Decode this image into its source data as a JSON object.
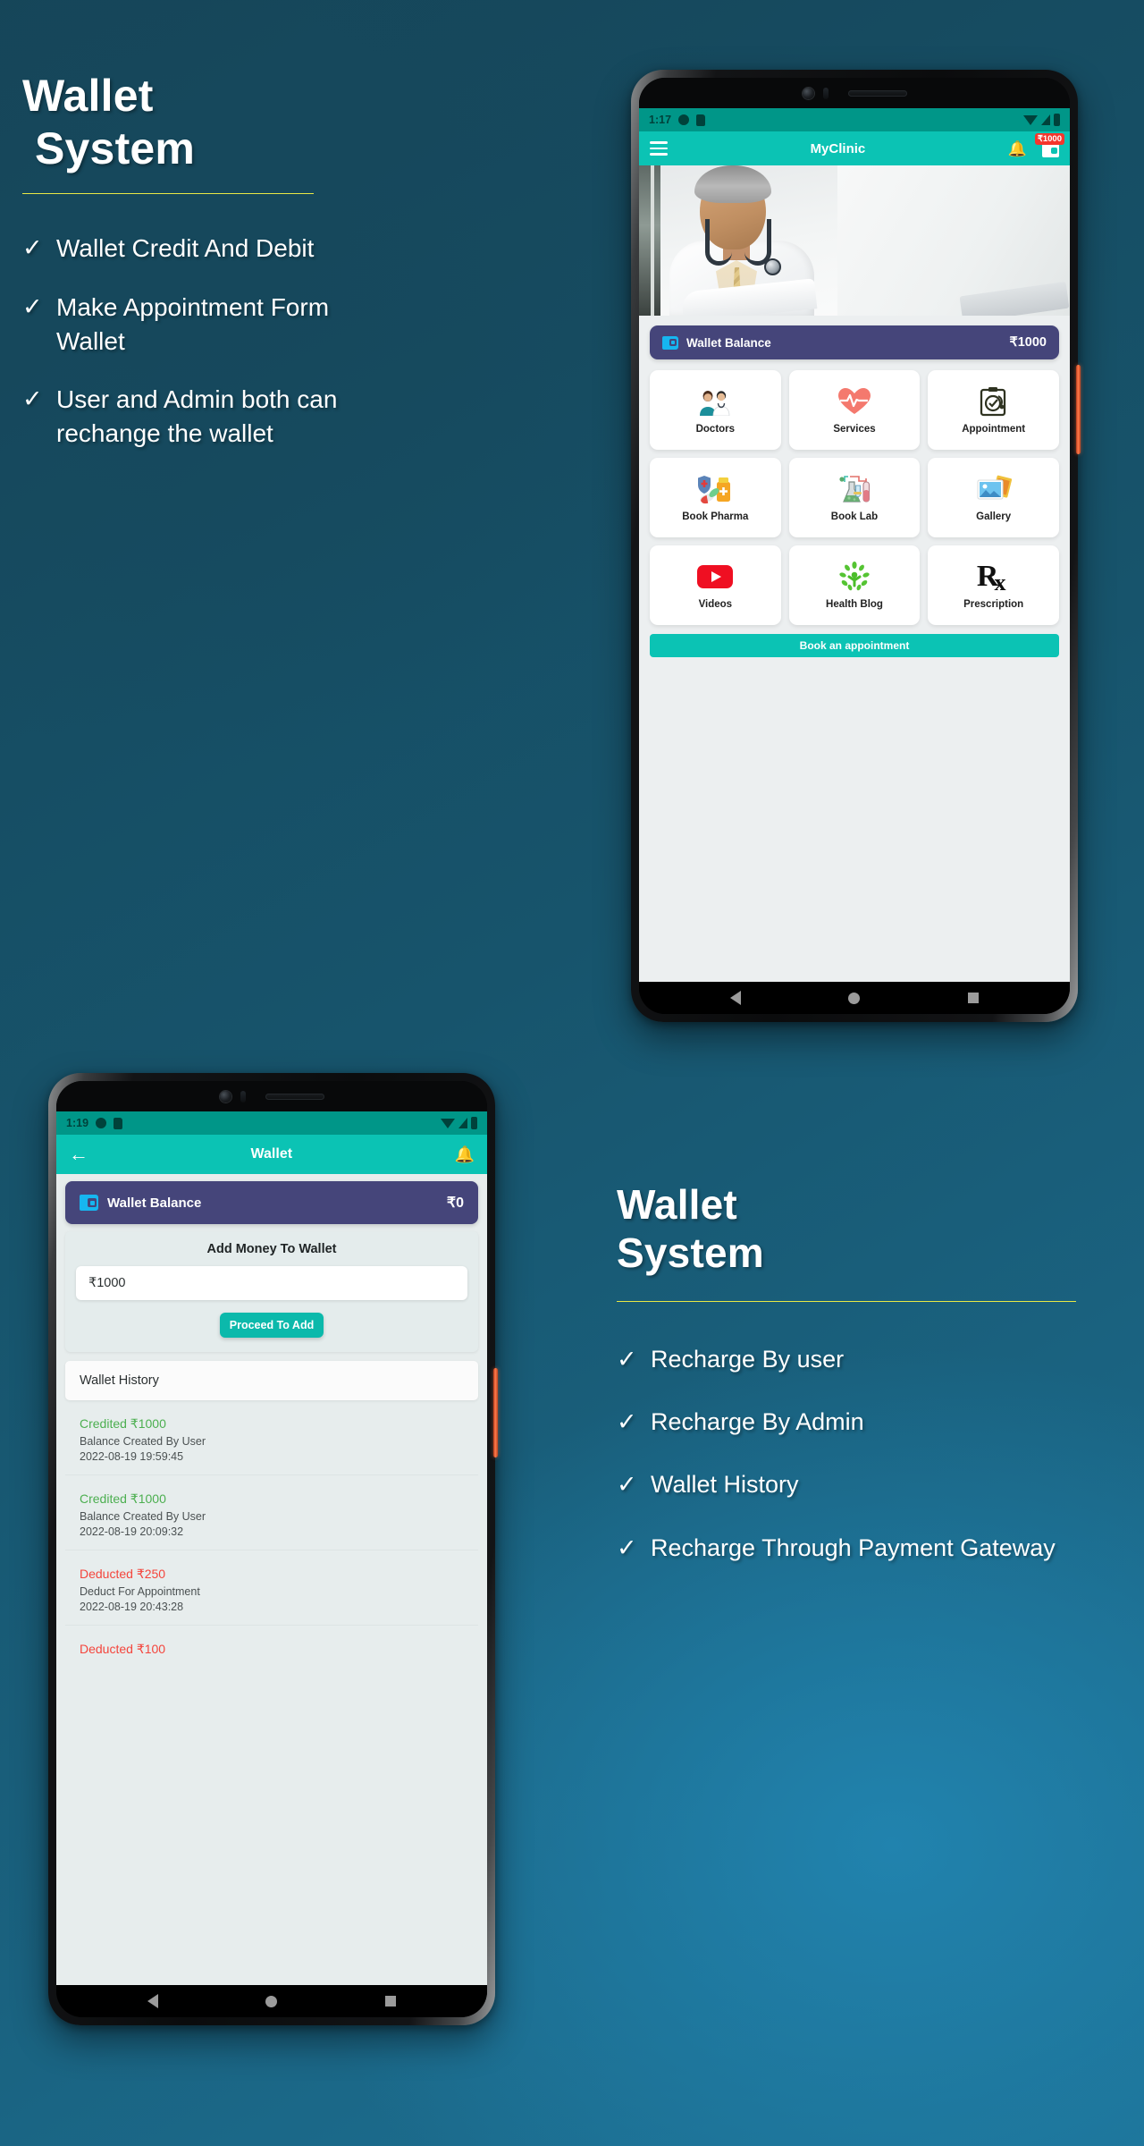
{
  "theme": {
    "bg_dark": "#154457",
    "bg_light": "#1d7296",
    "accent_teal": "#0bc3b4",
    "status_teal": "#009688",
    "wallet_purple": "#45457a",
    "wallet_icon_blue": "#16b6f0",
    "rule_yellow": "#e8e845",
    "credit_green": "#4caf50",
    "debit_red": "#f4453c",
    "badge_red": "#f5352c"
  },
  "promo_top": {
    "title_line1": "Wallet",
    "title_line2": "System",
    "bullets": [
      {
        "tick": "✓",
        "text": "Wallet Credit And Debit"
      },
      {
        "tick": "✓",
        "text": "Make Appointment Form Wallet"
      },
      {
        "tick": "✓",
        "text": "User and Admin both can rechange the wallet"
      }
    ]
  },
  "promo_bottom": {
    "title_line1": "Wallet",
    "title_line2": "System",
    "bullets": [
      {
        "tick": "✓",
        "text": "Recharge By user"
      },
      {
        "tick": "✓",
        "text": "Recharge By Admin"
      },
      {
        "tick": "✓",
        "text": "Wallet History"
      },
      {
        "tick": "✓",
        "text": "Recharge Through Payment Gateway"
      }
    ]
  },
  "phone_home": {
    "statusbar": {
      "time": "1:17",
      "icons": [
        "clock-dot-icon",
        "sd-card-icon",
        "wifi-icon",
        "signal-icon",
        "battery-icon"
      ]
    },
    "appbar": {
      "menu_icon": "hamburger-menu-icon",
      "title": "MyClinic",
      "notification_icon": "bell-icon",
      "wallet_icon": "wallet-icon",
      "wallet_badge": "₹1000"
    },
    "hero_image_alt": "doctor-with-stethoscope-photo",
    "wallet_bar": {
      "icon": "wallet-icon",
      "label": "Wallet Balance",
      "amount": "₹1000"
    },
    "tiles": [
      {
        "label": "Doctors",
        "icon": "doctors-photo-icon"
      },
      {
        "label": "Services",
        "icon": "heart-pulse-icon"
      },
      {
        "label": "Appointment",
        "icon": "clipboard-check-icon"
      },
      {
        "label": "Book Pharma",
        "icon": "medicine-bottle-icon"
      },
      {
        "label": "Book Lab",
        "icon": "lab-flask-icon"
      },
      {
        "label": "Gallery",
        "icon": "photos-icon"
      },
      {
        "label": "Videos",
        "icon": "youtube-icon"
      },
      {
        "label": "Health Blog",
        "icon": "green-person-tree-icon"
      },
      {
        "label": "Prescription",
        "icon": "rx-symbol-icon"
      }
    ],
    "cta_label": "Book an appointment",
    "navbar": [
      "back-triangle-icon",
      "home-circle-icon",
      "recents-square-icon"
    ]
  },
  "phone_wallet": {
    "statusbar": {
      "time": "1:19",
      "icons": [
        "clock-dot-icon",
        "sd-card-icon",
        "wifi-icon",
        "signal-icon",
        "battery-icon"
      ]
    },
    "appbar": {
      "back_icon": "back-arrow-icon",
      "title": "Wallet",
      "notification_icon": "bell-icon"
    },
    "wallet_bar": {
      "icon": "wallet-icon",
      "label": "Wallet Balance",
      "amount": "₹0"
    },
    "add_money": {
      "title": "Add Money To Wallet",
      "input_value": "₹1000",
      "button_label": "Proceed To Add"
    },
    "history_header": "Wallet History",
    "history": [
      {
        "amount": "Credited ₹1000",
        "type": "credit",
        "desc": "Balance Created By User",
        "date": "2022-08-19 19:59:45"
      },
      {
        "amount": "Credited ₹1000",
        "type": "credit",
        "desc": "Balance Created By User",
        "date": "2022-08-19 20:09:32"
      },
      {
        "amount": "Deducted ₹250",
        "type": "debit",
        "desc": "Deduct For Appointment",
        "date": "2022-08-19 20:43:28"
      },
      {
        "amount": "Deducted ₹100",
        "type": "debit",
        "desc": "",
        "date": ""
      }
    ],
    "navbar": [
      "back-triangle-icon",
      "home-circle-icon",
      "recents-square-icon"
    ]
  }
}
